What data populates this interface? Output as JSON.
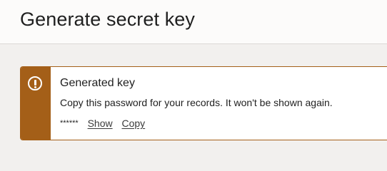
{
  "header": {
    "title": "Generate secret key"
  },
  "banner": {
    "icon": "warning-icon",
    "accent_color": "#a45f18",
    "heading": "Generated key",
    "message": "Copy this password for your records. It won't be shown again.",
    "masked_key": "******",
    "show_label": "Show",
    "copy_label": "Copy"
  }
}
